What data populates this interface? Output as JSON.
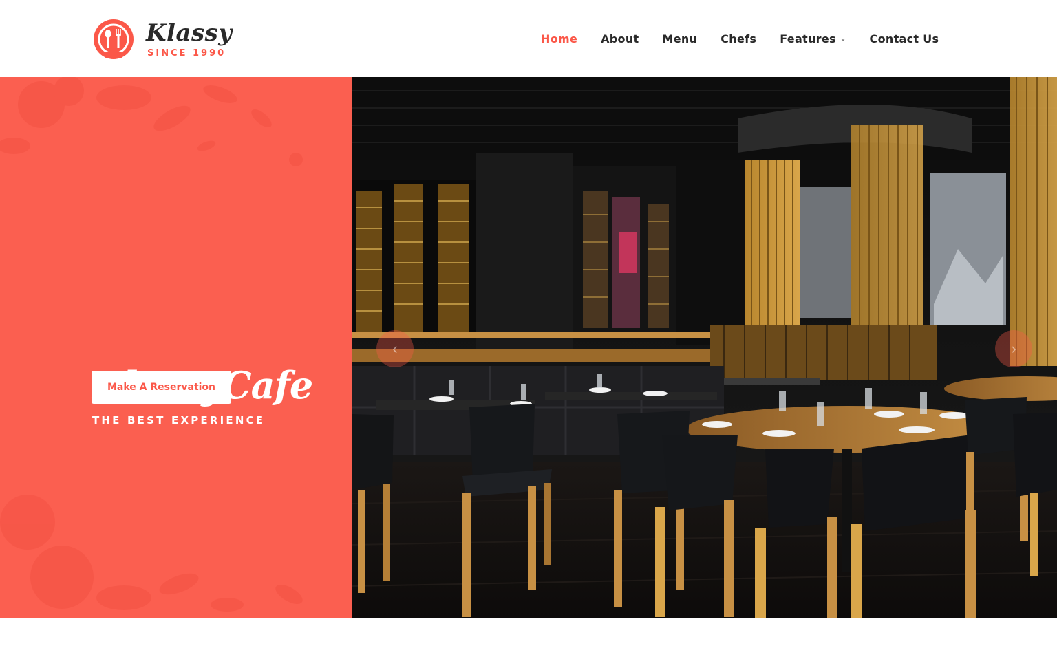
{
  "brand": {
    "name": "Klassy",
    "tagline": "SINCE 1990",
    "accent_color": "#fb5849",
    "logo_icon": "fork-spoon-icon"
  },
  "nav": {
    "items": [
      {
        "label": "Home",
        "active": true
      },
      {
        "label": "About",
        "active": false
      },
      {
        "label": "Menu",
        "active": false
      },
      {
        "label": "Chefs",
        "active": false
      },
      {
        "label": "Features",
        "active": false,
        "dropdown": true
      },
      {
        "label": "Contact Us",
        "active": false
      }
    ]
  },
  "hero": {
    "title": "KlassyCafe",
    "subtitle": "THE BEST EXPERIENCE",
    "cta_label": "Make A Reservation",
    "panel_color": "#fb5f50",
    "slider": {
      "prev_icon": "chevron-left-icon",
      "next_icon": "chevron-right-icon"
    }
  }
}
